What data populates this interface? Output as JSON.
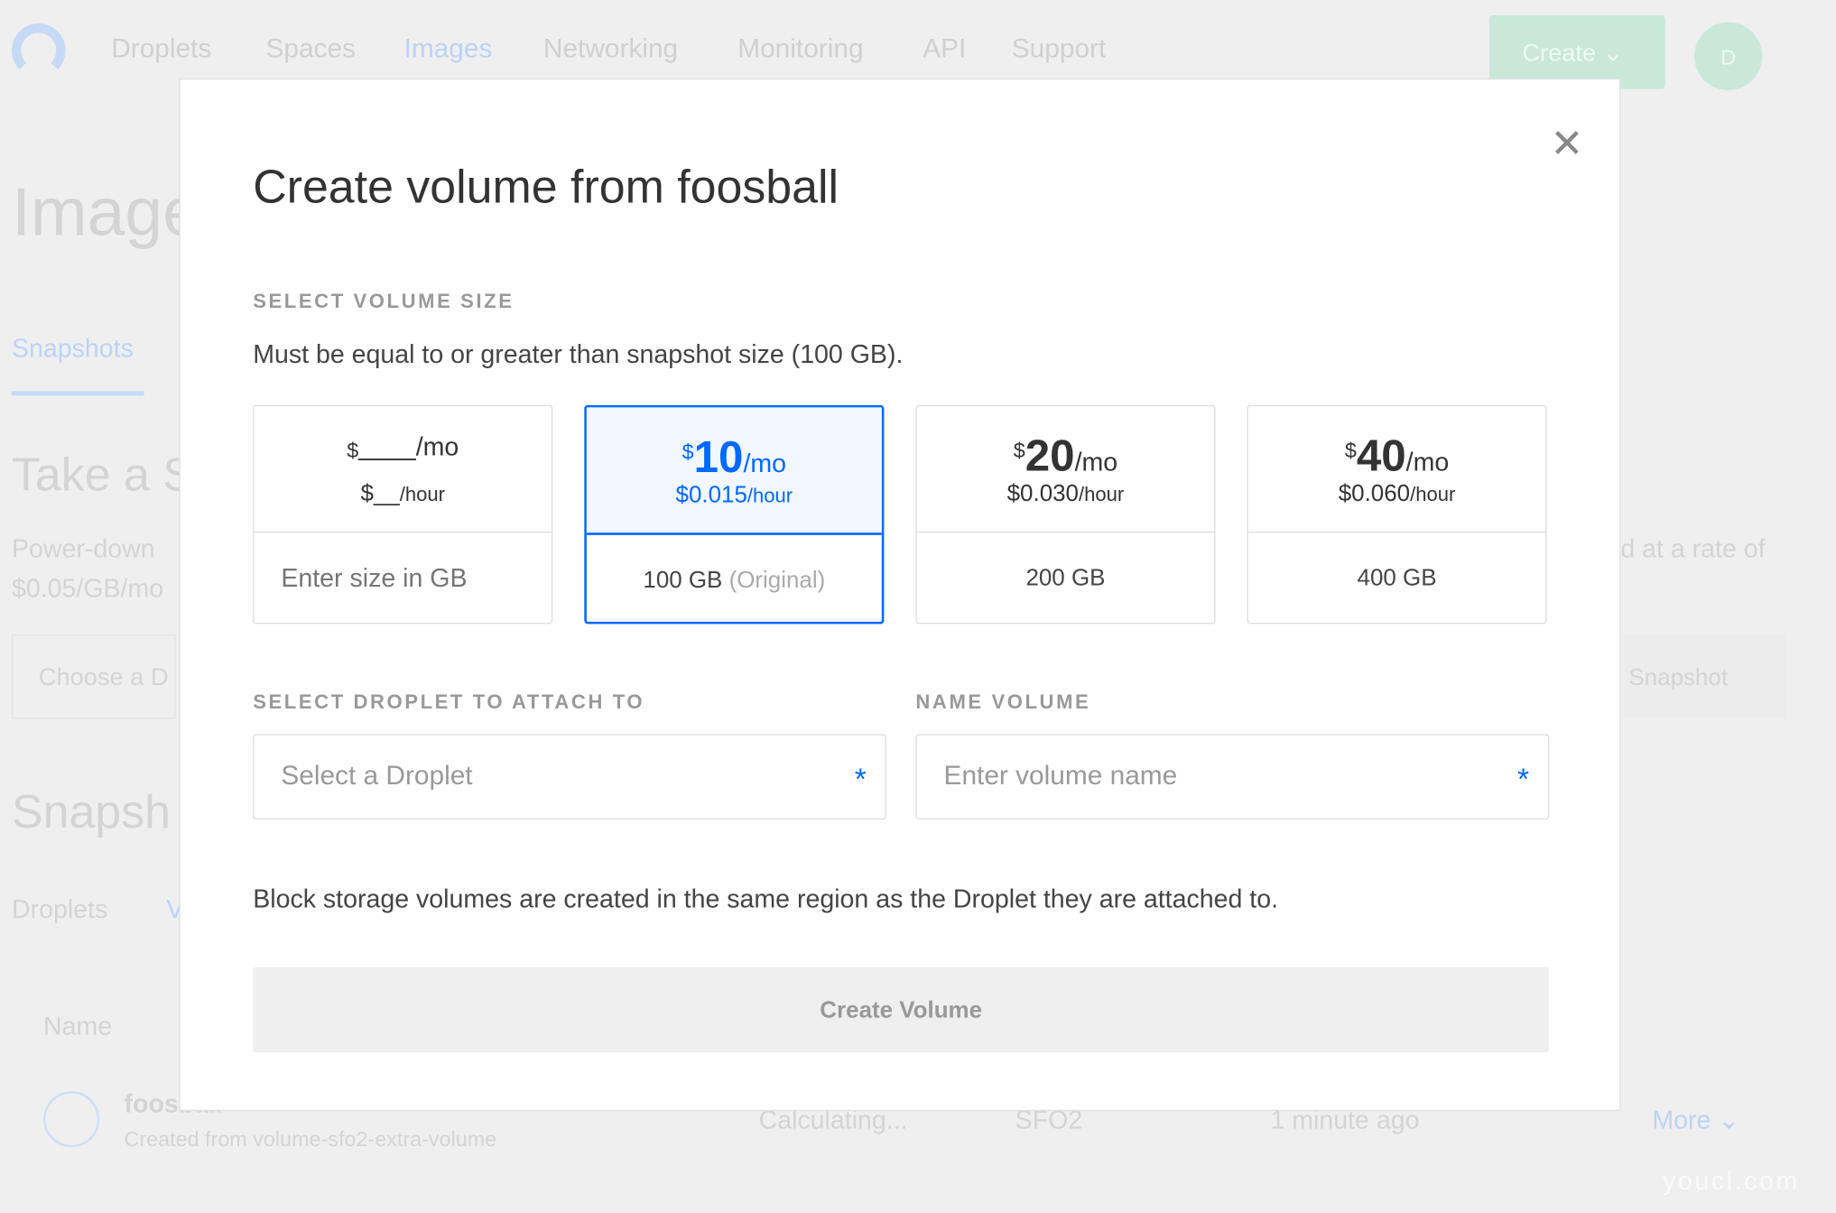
{
  "nav": {
    "items": [
      "Droplets",
      "Spaces",
      "Images",
      "Networking",
      "Monitoring",
      "API",
      "Support"
    ],
    "active": "Images",
    "create_label": "Create",
    "avatar_letter": "D"
  },
  "background": {
    "page_title": "Images",
    "tab_snapshots": "Snapshots",
    "take_snapshot_heading": "Take a S",
    "power_down_text": "Power-down",
    "rate_text": "$0.05/GB/mo",
    "rate_suffix": "d at a rate of",
    "choose_placeholder": "Choose a D",
    "snapshot_button": "Snapshot",
    "snapshots_heading": "Snapsh",
    "subtab_droplets": "Droplets",
    "subtab_volumes": "V",
    "table_header_name": "Name",
    "row": {
      "name": "foosball",
      "subtitle": "Created from volume-sfo2-extra-volume",
      "size": "Calculating...",
      "region": "SFO2",
      "created": "1 minute ago",
      "more": "More"
    }
  },
  "modal": {
    "title": "Create volume from foosball",
    "size_label": "SELECT VOLUME SIZE",
    "size_hint": "Must be equal to or greater than snapshot size (100 GB).",
    "sizes": [
      {
        "currency": "$",
        "amount": "____",
        "per_mo": "/mo",
        "hourly": "$__",
        "per_hour": "/hour",
        "size": "",
        "placeholder": "Enter size in GB",
        "selected": false
      },
      {
        "currency": "$",
        "amount": "10",
        "per_mo": "/mo",
        "hourly": "$0.015",
        "per_hour": "/hour",
        "size": "100 GB",
        "note": "(Original)",
        "selected": true
      },
      {
        "currency": "$",
        "amount": "20",
        "per_mo": "/mo",
        "hourly": "$0.030",
        "per_hour": "/hour",
        "size": "200 GB",
        "selected": false
      },
      {
        "currency": "$",
        "amount": "40",
        "per_mo": "/mo",
        "hourly": "$0.060",
        "per_hour": "/hour",
        "size": "400 GB",
        "selected": false
      }
    ],
    "droplet_label": "SELECT DROPLET TO ATTACH TO",
    "droplet_placeholder": "Select a Droplet",
    "name_label": "NAME VOLUME",
    "name_placeholder": "Enter volume name",
    "required_mark": "*",
    "info": "Block storage volumes are created in the same region as the Droplet they are attached to.",
    "submit_label": "Create Volume"
  },
  "watermark": "youcl.com",
  "colors": {
    "accent": "#0069ff",
    "selected_bg": "#f3f7ff",
    "create_button": "#c9e8d8"
  }
}
